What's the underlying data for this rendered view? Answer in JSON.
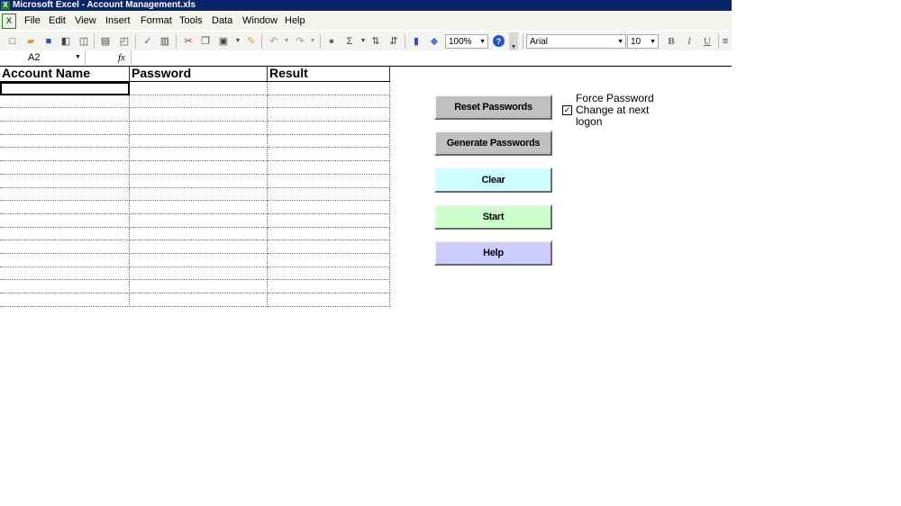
{
  "window": {
    "title": "Microsoft Excel - Account Management.xls",
    "app_icon": "excel-icon"
  },
  "menu": {
    "items": [
      "File",
      "Edit",
      "View",
      "Insert",
      "Format",
      "Tools",
      "Data",
      "Window",
      "Help"
    ]
  },
  "toolbar": {
    "zoom": "100%",
    "font_name": "Arial",
    "font_size": "10",
    "bold": "B",
    "italic": "I",
    "underline": "U"
  },
  "formula_bar": {
    "name_box": "A2",
    "fx_label": "fx",
    "formula": ""
  },
  "sheet": {
    "headers": [
      "Account Name",
      "Password",
      "Result"
    ],
    "active_cell": "A2",
    "empty_rows": 17
  },
  "buttons": {
    "reset": "Reset Passwords",
    "generate": "Generate Passwords",
    "clear": "Clear",
    "start": "Start",
    "help": "Help"
  },
  "button_colors": {
    "reset": "#c0c0c0",
    "generate": "#c0c0c0",
    "clear": "#ccffff",
    "start": "#ccffcc",
    "help": "#ccccff"
  },
  "force_password_change": {
    "label": "Force Password Change at next logon",
    "checked": true,
    "check_glyph": "✓"
  }
}
